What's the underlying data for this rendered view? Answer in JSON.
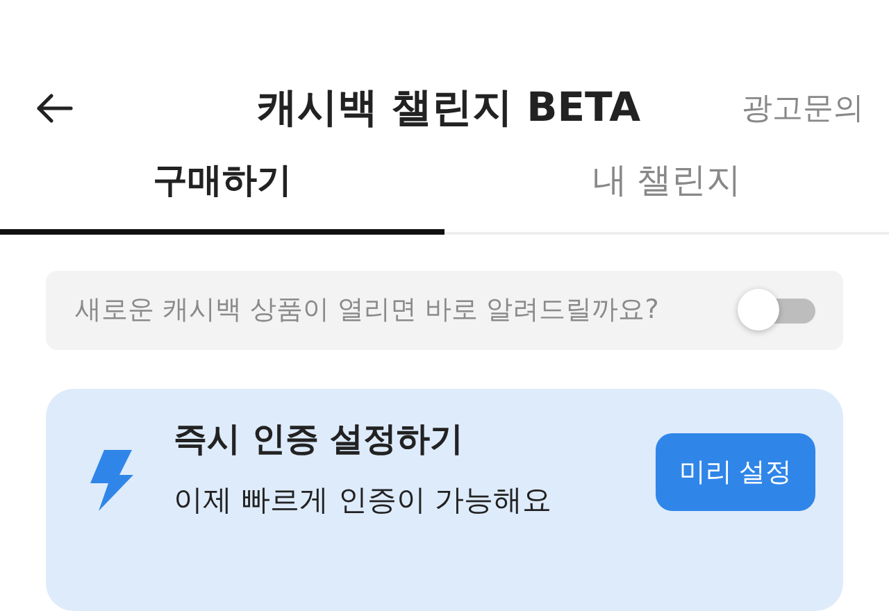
{
  "header": {
    "title": "캐시백 챌린지 BETA",
    "action": "광고문의"
  },
  "tabs": [
    {
      "label": "구매하기",
      "selected": true
    },
    {
      "label": "내 챌린지",
      "selected": false
    }
  ],
  "notice": {
    "text": "새로운 캐시백 상품이 열리면 바로 알려드릴까요?",
    "on": false
  },
  "promo": {
    "title": "즉시 인증 설정하기",
    "subtitle": "이제 빠르게 인증이 가능해요",
    "button": "미리 설정"
  }
}
